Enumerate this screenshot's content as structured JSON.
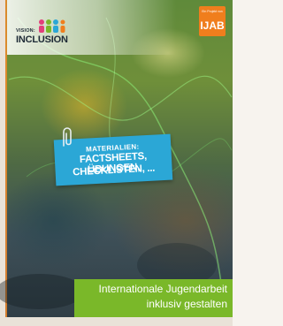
{
  "logo": {
    "line1": "VISION:",
    "line2": "INCLUSION",
    "people_colors": [
      "#e2407a",
      "#7ab829",
      "#2ba7d6",
      "#f07e1d"
    ]
  },
  "publisher": {
    "prefix": "Ein Projekt von",
    "name": "IJAB",
    "color": "#f07e1d"
  },
  "banner": {
    "kicker": "MATERIALIEN:",
    "title_line1": "FACTSHEETS, ÜBUNGEN,",
    "title_line2": "CHECKLISTEN, ...",
    "color": "#2ba7d6",
    "icon": "paperclip-icon"
  },
  "footer": {
    "line1": "Internationale Jugendarbeit",
    "line2": "inklusiv gestalten",
    "color": "#7ab829"
  }
}
